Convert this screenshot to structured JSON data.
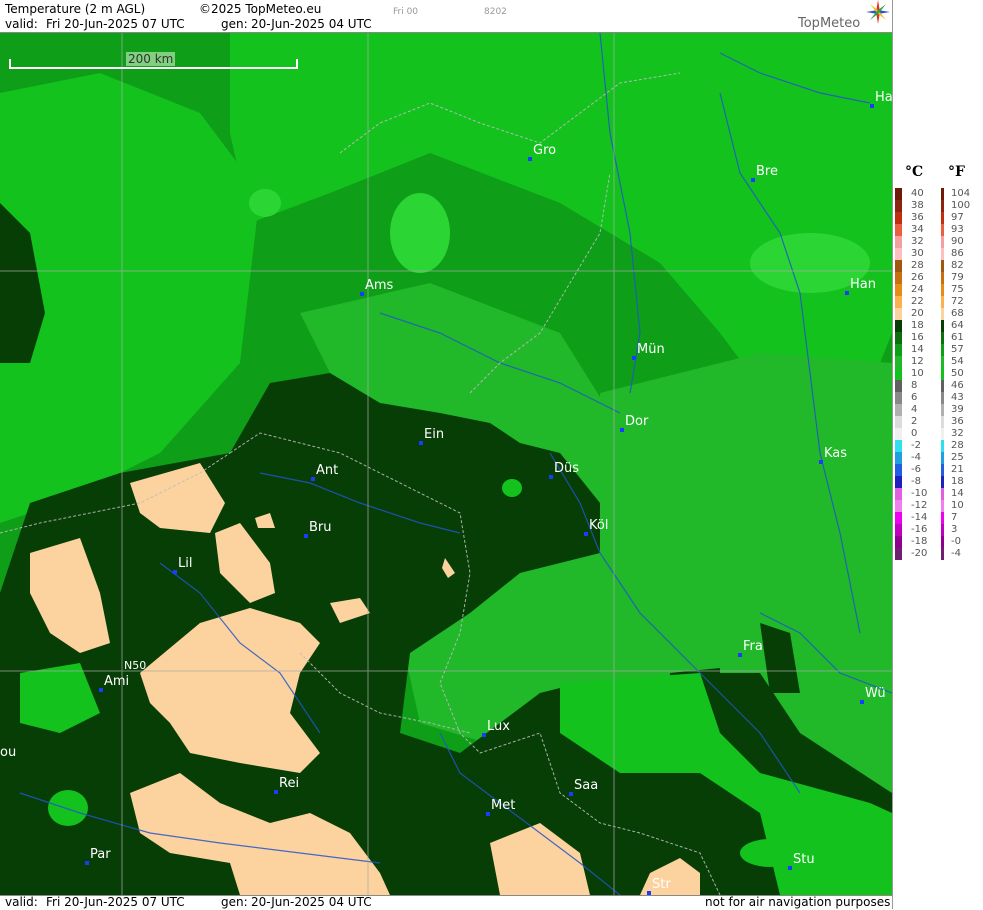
{
  "header": {
    "title": "Temperature (2 m AGL)",
    "copyright": "©2025 TopMeteo.eu",
    "small1": "Fri 00",
    "small2": "8202",
    "valid_label": "valid:",
    "valid_value": "Fri  20-Jun-2025  07 UTC",
    "gen_label": "gen:",
    "gen_value": "20-Jun-2025 04 UTC",
    "brand": "TopMeteo"
  },
  "map": {
    "scale_label": "200 km",
    "lat_label": "N50",
    "cities": [
      {
        "name": "Ha"
      },
      {
        "name": "Gro"
      },
      {
        "name": "Bre"
      },
      {
        "name": "Ams"
      },
      {
        "name": "Han"
      },
      {
        "name": "Mün"
      },
      {
        "name": "Dor"
      },
      {
        "name": "Ein"
      },
      {
        "name": "Kas"
      },
      {
        "name": "Düs"
      },
      {
        "name": "Ant"
      },
      {
        "name": "Köl"
      },
      {
        "name": "Bru"
      },
      {
        "name": "Lil"
      },
      {
        "name": "Fra"
      },
      {
        "name": "Ami"
      },
      {
        "name": "Wü"
      },
      {
        "name": "Lux"
      },
      {
        "name": "Rei"
      },
      {
        "name": "Saa"
      },
      {
        "name": "Met"
      },
      {
        "name": "ou"
      },
      {
        "name": "Par"
      },
      {
        "name": "Stu"
      },
      {
        "name": "Str"
      }
    ],
    "colors": {
      "band_10_12": "#0e9e18",
      "band_12_14": "#21b82a",
      "band_14_16": "#14c21e",
      "band_16_18": "#063e06",
      "band_20_plus": "#fcd39e",
      "rivers": "#2255cc",
      "borders": "#bbbbbb"
    }
  },
  "footer": {
    "valid_label": "valid:",
    "valid_value": "Fri  20-Jun-2025  07 UTC",
    "gen_label": "gen:",
    "gen_value": "20-Jun-2025 04 UTC",
    "disclaimer": "not for air navigation purposes"
  },
  "legend": {
    "celsius_unit": "°C",
    "fahrenheit_unit": "°F",
    "celsius": [
      "40",
      "38",
      "36",
      "34",
      "32",
      "30",
      "28",
      "26",
      "24",
      "22",
      "20",
      "18",
      "16",
      "14",
      "12",
      "10",
      "8",
      "6",
      "4",
      "2",
      "0",
      "-2",
      "-4",
      "-6",
      "-8",
      "-10",
      "-12",
      "-14",
      "-16",
      "-18",
      "-20"
    ],
    "fahrenheit": [
      "104",
      "100",
      "97",
      "93",
      "90",
      "86",
      "82",
      "79",
      "75",
      "72",
      "68",
      "64",
      "61",
      "57",
      "54",
      "50",
      "46",
      "43",
      "39",
      "36",
      "32",
      "28",
      "25",
      "21",
      "18",
      "14",
      "10",
      "7",
      "3",
      "-0",
      "-4"
    ],
    "colors": [
      "#6e1a08",
      "#8c2410",
      "#c03010",
      "#e86040",
      "#f4a0a0",
      "#fcc0c0",
      "#a05810",
      "#c87010",
      "#e88c18",
      "#fcb050",
      "#fcd39e",
      "#063e06",
      "#0c7010",
      "#0e9e18",
      "#21b82a",
      "#14c21e",
      "#606060",
      "#888888",
      "#b0b0b0",
      "#dcdcdc",
      "#f0f0f0",
      "#30e0f0",
      "#20a0e0",
      "#2060e0",
      "#2020c0",
      "#e060e0",
      "#f080f0",
      "#f000f0",
      "#c000c0",
      "#900090",
      "#702070"
    ]
  }
}
